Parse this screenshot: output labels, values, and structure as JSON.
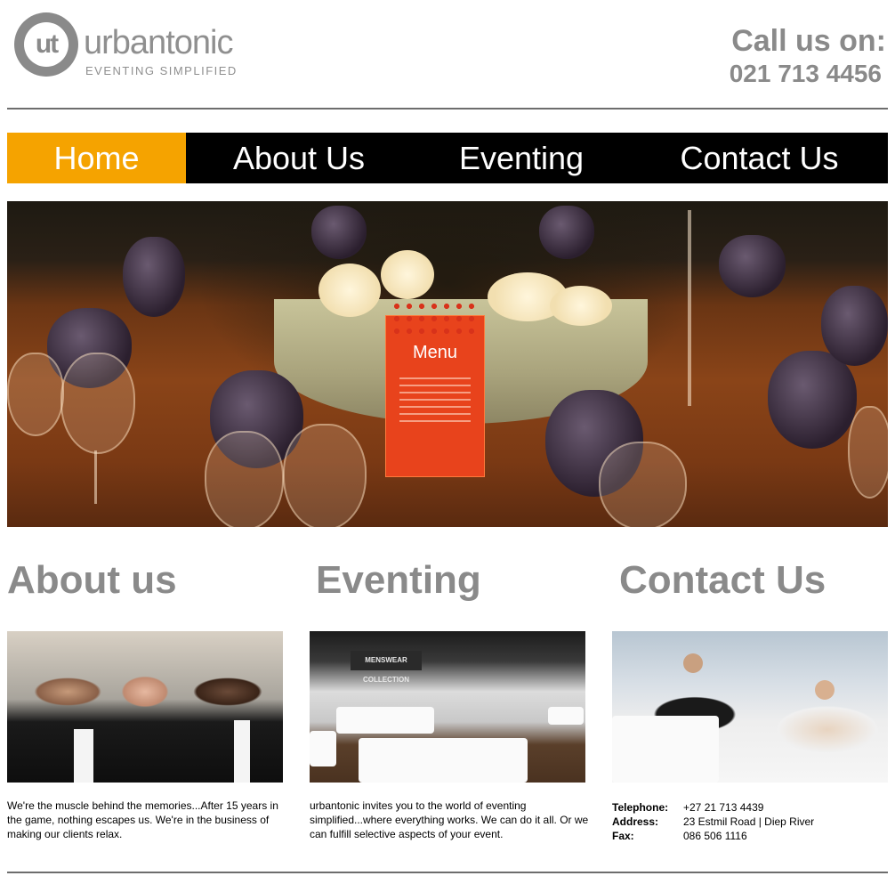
{
  "brand": {
    "logo_mark": "ut",
    "name": "urbantonic",
    "tagline": "EVENTING SIMPLIFIED",
    "color": "#8a8a8a"
  },
  "header": {
    "call_label": "Call us on:",
    "phone": "021 713 4456"
  },
  "nav": {
    "items": [
      {
        "label": "Home",
        "active": true
      },
      {
        "label": "About Us",
        "active": false
      },
      {
        "label": "Eventing",
        "active": false
      },
      {
        "label": "Contact Us",
        "active": false
      }
    ],
    "active_color": "#f5a300",
    "bg_color": "#000000"
  },
  "hero": {
    "menu_card_title": "Menu"
  },
  "sections": {
    "about": {
      "heading": "About us",
      "text": "We're the muscle behind the memories...After 15 years in the game, nothing escapes us. We're in the business of making our clients relax."
    },
    "eventing": {
      "heading": "Eventing",
      "photo_banner": "MENSWEAR COLLECTION",
      "text": "urbantonic invites you to the world of eventing simplified...where everything works. We can do it all. Or we can fulfill selective aspects of your event."
    },
    "contact": {
      "heading": "Contact Us",
      "telephone_label": "Telephone:",
      "telephone": "+27 21 713 4439",
      "address_label": "Address:",
      "address": "23 Estmil Road | Diep River",
      "fax_label": "Fax:",
      "fax": "086 506 1116"
    }
  }
}
